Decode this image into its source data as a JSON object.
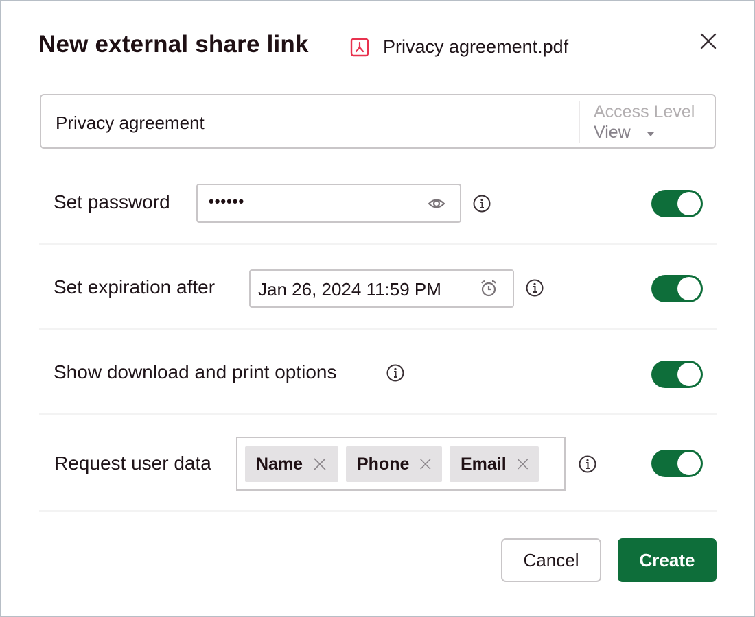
{
  "dialog": {
    "title": "New external share link",
    "file": {
      "icon": "pdf-icon",
      "name": "Privacy agreement.pdf"
    },
    "close_icon": "close-icon"
  },
  "link_name": {
    "value": "Privacy agreement",
    "access_level_label": "Access Level",
    "access_level_value": "View"
  },
  "options": {
    "password": {
      "label": "Set password",
      "value": "••••••",
      "toggle_on": true,
      "icon": "eye-icon"
    },
    "expiration": {
      "label": "Set expiration after",
      "value": "Jan 26, 2024 11:59 PM",
      "toggle_on": true,
      "icon": "alarm-clock-icon"
    },
    "download_print": {
      "label": "Show download and print options",
      "toggle_on": true
    },
    "user_data": {
      "label": "Request user data",
      "tags": [
        "Name",
        "Phone",
        "Email"
      ],
      "toggle_on": true
    }
  },
  "footer": {
    "cancel_label": "Cancel",
    "create_label": "Create"
  },
  "colors": {
    "accent": "#0e6e3a",
    "pdf_icon": "#e8334f",
    "border": "#c9c6c8"
  }
}
